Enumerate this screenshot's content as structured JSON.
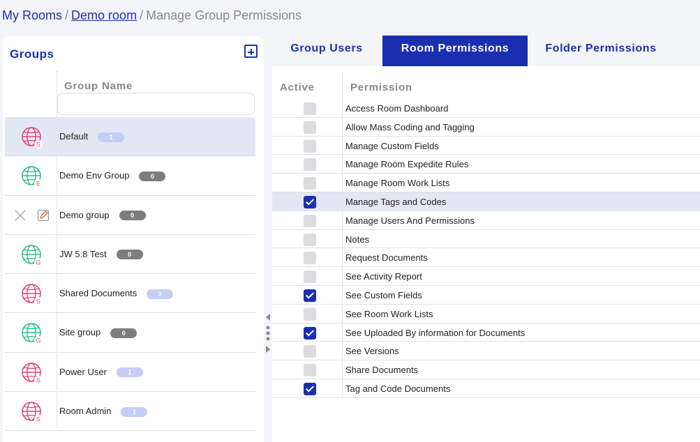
{
  "breadcrumb": {
    "my_rooms": "My Rooms",
    "sep1": "/",
    "room": "Demo room",
    "sep2": "/",
    "current": "Manage Group Permissions"
  },
  "groups_panel": {
    "title": "Groups",
    "column_header": "Group Name",
    "filter_value": "",
    "groups": [
      {
        "name": "Default",
        "count": "1",
        "icon": "globe-icon",
        "icon_letter": "S",
        "icon_color": "#e0457b",
        "badge_style": "light",
        "selected": true
      },
      {
        "name": "Demo Env Group",
        "count": "0",
        "icon": "globe-icon",
        "icon_letter": "E",
        "icon_color": "#2cc08a",
        "letter_color": "#e8632a",
        "badge_style": "dark",
        "selected": false
      },
      {
        "name": "Demo group",
        "count": "0",
        "icon": "none",
        "badge_style": "dark",
        "selected": false,
        "actions": [
          "close-icon",
          "edit-icon"
        ]
      },
      {
        "name": "JW 5.8 Test",
        "count": "0",
        "icon": "globe-icon",
        "icon_letter": "G",
        "icon_color": "#2cc08a",
        "letter_color": "#e0457b",
        "badge_style": "dark",
        "selected": false
      },
      {
        "name": "Shared Documents",
        "count": "3",
        "icon": "globe-icon",
        "icon_letter": "S",
        "icon_color": "#e0457b",
        "badge_style": "light",
        "selected": false
      },
      {
        "name": "Site group",
        "count": "0",
        "icon": "globe-icon",
        "icon_letter": "G",
        "icon_color": "#2cc08a",
        "letter_color": "#e0457b",
        "badge_style": "dark",
        "selected": false
      },
      {
        "name": "Power User",
        "count": "1",
        "icon": "globe-icon",
        "icon_letter": "S",
        "icon_color": "#e0457b",
        "badge_style": "light",
        "selected": false
      },
      {
        "name": "Room Admin",
        "count": "1",
        "icon": "globe-icon",
        "icon_letter": "S",
        "icon_color": "#e0457b",
        "badge_style": "light",
        "selected": false
      }
    ]
  },
  "tabs": [
    {
      "label": "Group Users",
      "active": false
    },
    {
      "label": "Room Permissions",
      "active": true
    },
    {
      "label": "Folder Permissions",
      "active": false
    }
  ],
  "permissions": {
    "header_active": "Active",
    "header_permission": "Permission",
    "rows": [
      {
        "label": "Access Room Dashboard",
        "checked": false,
        "selected": false
      },
      {
        "label": "Allow Mass Coding and Tagging",
        "checked": false,
        "selected": false
      },
      {
        "label": "Manage Custom Fields",
        "checked": false,
        "selected": false
      },
      {
        "label": "Manage Room Expedite Rules",
        "checked": false,
        "selected": false
      },
      {
        "label": "Manage Room Work Lists",
        "checked": false,
        "selected": false
      },
      {
        "label": "Manage Tags and Codes",
        "checked": true,
        "selected": true
      },
      {
        "label": "Manage Users And Permissions",
        "checked": false,
        "selected": false
      },
      {
        "label": "Notes",
        "checked": false,
        "selected": false
      },
      {
        "label": "Request Documents",
        "checked": false,
        "selected": false
      },
      {
        "label": "See Activity Report",
        "checked": false,
        "selected": false
      },
      {
        "label": "See Custom Fields",
        "checked": true,
        "selected": false
      },
      {
        "label": "See Room Work Lists",
        "checked": false,
        "selected": false
      },
      {
        "label": "See Uploaded By information for Documents",
        "checked": true,
        "selected": false
      },
      {
        "label": "See Versions",
        "checked": false,
        "selected": false
      },
      {
        "label": "Share Documents",
        "checked": false,
        "selected": false
      },
      {
        "label": "Tag and Code Documents",
        "checked": true,
        "selected": false
      }
    ]
  },
  "colors": {
    "accent": "#1a2fb0",
    "selected_row": "#e3e7f4",
    "badge_light": "#c5cdf6",
    "badge_dark": "#7d7d7d"
  }
}
